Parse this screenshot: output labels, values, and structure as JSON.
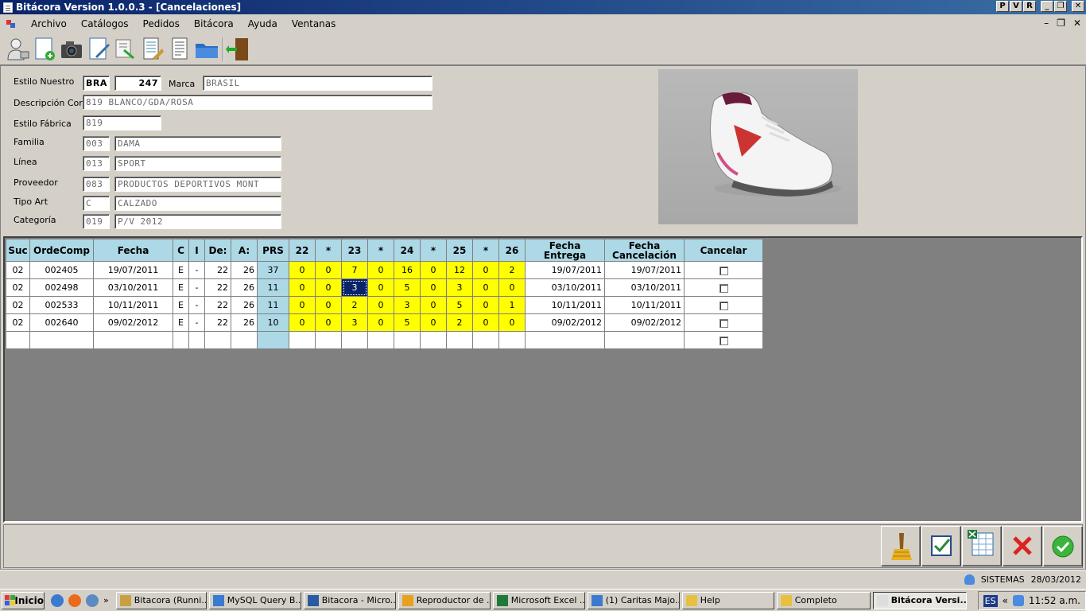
{
  "window": {
    "title": "Bitácora Version 1.0.0.3 - [Cancelaciones]",
    "buttons": [
      "P",
      "V",
      "R",
      "_",
      "❐",
      "✕"
    ]
  },
  "menu": {
    "items": [
      "Archivo",
      "Catálogos",
      "Pedidos",
      "Bitácora",
      "Ayuda",
      "Ventanas"
    ],
    "mdi_buttons": [
      "–",
      "❐",
      "✕"
    ]
  },
  "toolbar": {
    "icons": [
      "user-icon",
      "new-document-icon",
      "camera-icon",
      "edit-document-icon",
      "export-icon",
      "report-icon",
      "list-document-icon",
      "folder-icon",
      "exit-door-icon"
    ]
  },
  "form": {
    "estilo_nuestro": {
      "label": "Estilo Nuestro",
      "prefix": "BRA",
      "number": "247"
    },
    "marca": {
      "label": "Marca",
      "value": "BRASIL"
    },
    "descripcion": {
      "label": "Descripción Corta",
      "value": "819 BLANCO/GDA/ROSA"
    },
    "estilo_fabrica": {
      "label": "Estilo Fábrica",
      "value": "819"
    },
    "familia": {
      "label": "Familia",
      "code": "003",
      "name": "DAMA"
    },
    "linea": {
      "label": "Línea",
      "code": "013",
      "name": "SPORT"
    },
    "proveedor": {
      "label": "Proveedor",
      "code": "083",
      "name": "PRODUCTOS DEPORTIVOS MONT"
    },
    "tipo_art": {
      "label": "Tipo Art",
      "code": "C",
      "name": "CALZADO"
    },
    "categoria": {
      "label": "Categoría",
      "code": "019",
      "name": "P/V 2012"
    }
  },
  "grid": {
    "headers": [
      "Suc",
      "OrdeComp",
      "Fecha",
      "C",
      "I",
      "De:",
      "A:",
      "PRS",
      "22",
      "*",
      "23",
      "*",
      "24",
      "*",
      "25",
      "*",
      "26",
      "Fecha Entrega",
      "Fecha Cancelación",
      "Cancelar"
    ],
    "header_fecha_entrega": [
      "Fecha",
      "Entrega"
    ],
    "header_fecha_cancelacion": [
      "Fecha",
      "Cancelación"
    ],
    "rows": [
      [
        "02",
        "002405",
        "19/07/2011",
        "E",
        "-",
        "22",
        "26",
        "37",
        "0",
        "0",
        "7",
        "0",
        "16",
        "0",
        "12",
        "0",
        "2",
        "19/07/2011",
        "19/07/2011"
      ],
      [
        "02",
        "002498",
        "03/10/2011",
        "E",
        "-",
        "22",
        "26",
        "11",
        "0",
        "0",
        "3",
        "0",
        "5",
        "0",
        "3",
        "0",
        "0",
        "03/10/2011",
        "03/10/2011"
      ],
      [
        "02",
        "002533",
        "10/11/2011",
        "E",
        "-",
        "22",
        "26",
        "11",
        "0",
        "0",
        "2",
        "0",
        "3",
        "0",
        "5",
        "0",
        "1",
        "10/11/2011",
        "10/11/2011"
      ],
      [
        "02",
        "002640",
        "09/02/2012",
        "E",
        "-",
        "22",
        "26",
        "10",
        "0",
        "0",
        "3",
        "0",
        "5",
        "0",
        "2",
        "0",
        "0",
        "09/02/2012",
        "09/02/2012"
      ]
    ],
    "selected_cell": {
      "row": 1,
      "col": 10
    }
  },
  "actions": [
    "broom-icon",
    "checkbox-icon",
    "excel-icon",
    "red-x-icon",
    "green-check-icon"
  ],
  "status": {
    "user": "SISTEMAS",
    "date": "28/03/2012"
  },
  "taskbar": {
    "start": "Inicio",
    "tasks": [
      {
        "label": "Bitacora (Runni...",
        "icon": "vb-icon",
        "active": false
      },
      {
        "label": "MySQL Query B...",
        "icon": "mysql-icon",
        "active": false
      },
      {
        "label": "Bitacora - Micro...",
        "icon": "word-icon",
        "active": false
      },
      {
        "label": "Reproductor de ...",
        "icon": "media-player-icon",
        "active": false
      },
      {
        "label": "Microsoft Excel ...",
        "icon": "excel-icon",
        "active": false
      },
      {
        "label": "(1) Caritas Majo...",
        "icon": "ie-icon",
        "active": false
      },
      {
        "label": "Help",
        "icon": "folder-icon",
        "active": false
      },
      {
        "label": "Completo",
        "icon": "folder-icon",
        "active": false
      },
      {
        "label": "Bitácora Versi...",
        "icon": "app-icon",
        "active": true
      }
    ],
    "lang": "ES",
    "clock": "11:52 a.m."
  }
}
